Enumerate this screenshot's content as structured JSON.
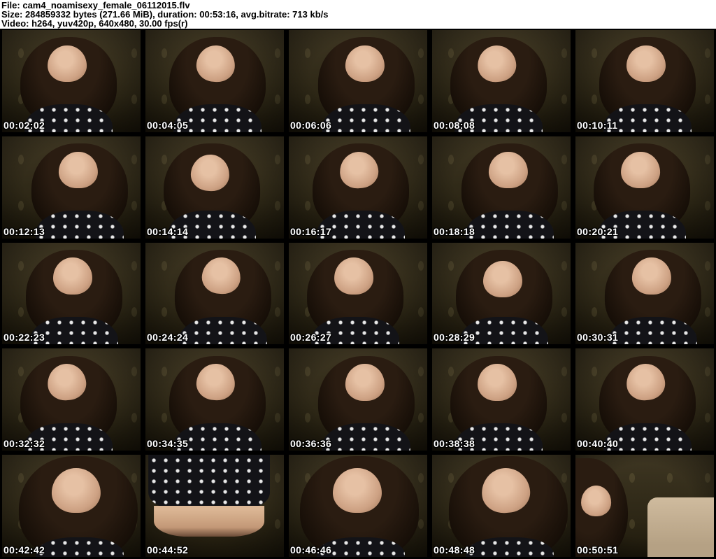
{
  "header": {
    "lines": [
      "File: cam4_noamisexy_female_06112015.flv",
      "Size: 284859332 bytes (271.66 MiB), duration: 00:53:16, avg.bitrate: 713 kb/s",
      "Video: h264, yuv420p, 640x480, 30.00 fps(r)"
    ]
  },
  "grid": {
    "columns": 5,
    "rows": 5
  },
  "thumbnails": [
    {
      "timestamp": "00:02:02",
      "variant": "portrait"
    },
    {
      "timestamp": "00:04:05",
      "variant": "portrait"
    },
    {
      "timestamp": "00:06:06",
      "variant": "portrait"
    },
    {
      "timestamp": "00:08:08",
      "variant": "portrait"
    },
    {
      "timestamp": "00:10:11",
      "variant": "portrait"
    },
    {
      "timestamp": "00:12:13",
      "variant": "portrait"
    },
    {
      "timestamp": "00:14:14",
      "variant": "portrait"
    },
    {
      "timestamp": "00:16:17",
      "variant": "portrait"
    },
    {
      "timestamp": "00:18:18",
      "variant": "portrait"
    },
    {
      "timestamp": "00:20:21",
      "variant": "portrait"
    },
    {
      "timestamp": "00:22:23",
      "variant": "portrait"
    },
    {
      "timestamp": "00:24:24",
      "variant": "portrait"
    },
    {
      "timestamp": "00:26:27",
      "variant": "portrait"
    },
    {
      "timestamp": "00:28:29",
      "variant": "portrait"
    },
    {
      "timestamp": "00:30:31",
      "variant": "portrait"
    },
    {
      "timestamp": "00:32:32",
      "variant": "portrait"
    },
    {
      "timestamp": "00:34:35",
      "variant": "portrait"
    },
    {
      "timestamp": "00:36:36",
      "variant": "portrait"
    },
    {
      "timestamp": "00:38:38",
      "variant": "portrait"
    },
    {
      "timestamp": "00:40:40",
      "variant": "portrait"
    },
    {
      "timestamp": "00:42:42",
      "variant": "closeup"
    },
    {
      "timestamp": "00:44:52",
      "variant": "torso"
    },
    {
      "timestamp": "00:46:46",
      "variant": "closeup"
    },
    {
      "timestamp": "00:48:48",
      "variant": "closeup"
    },
    {
      "timestamp": "00:50:51",
      "variant": "room"
    }
  ],
  "colors": {
    "header_bg": "#ffffff",
    "header_text": "#000000",
    "sheet_bg": "#000000",
    "timestamp_text": "#ffffff",
    "wallpaper": "#3e3622",
    "hair": "#1d140c",
    "skin": "#d8b296",
    "shirt": "#131317"
  }
}
